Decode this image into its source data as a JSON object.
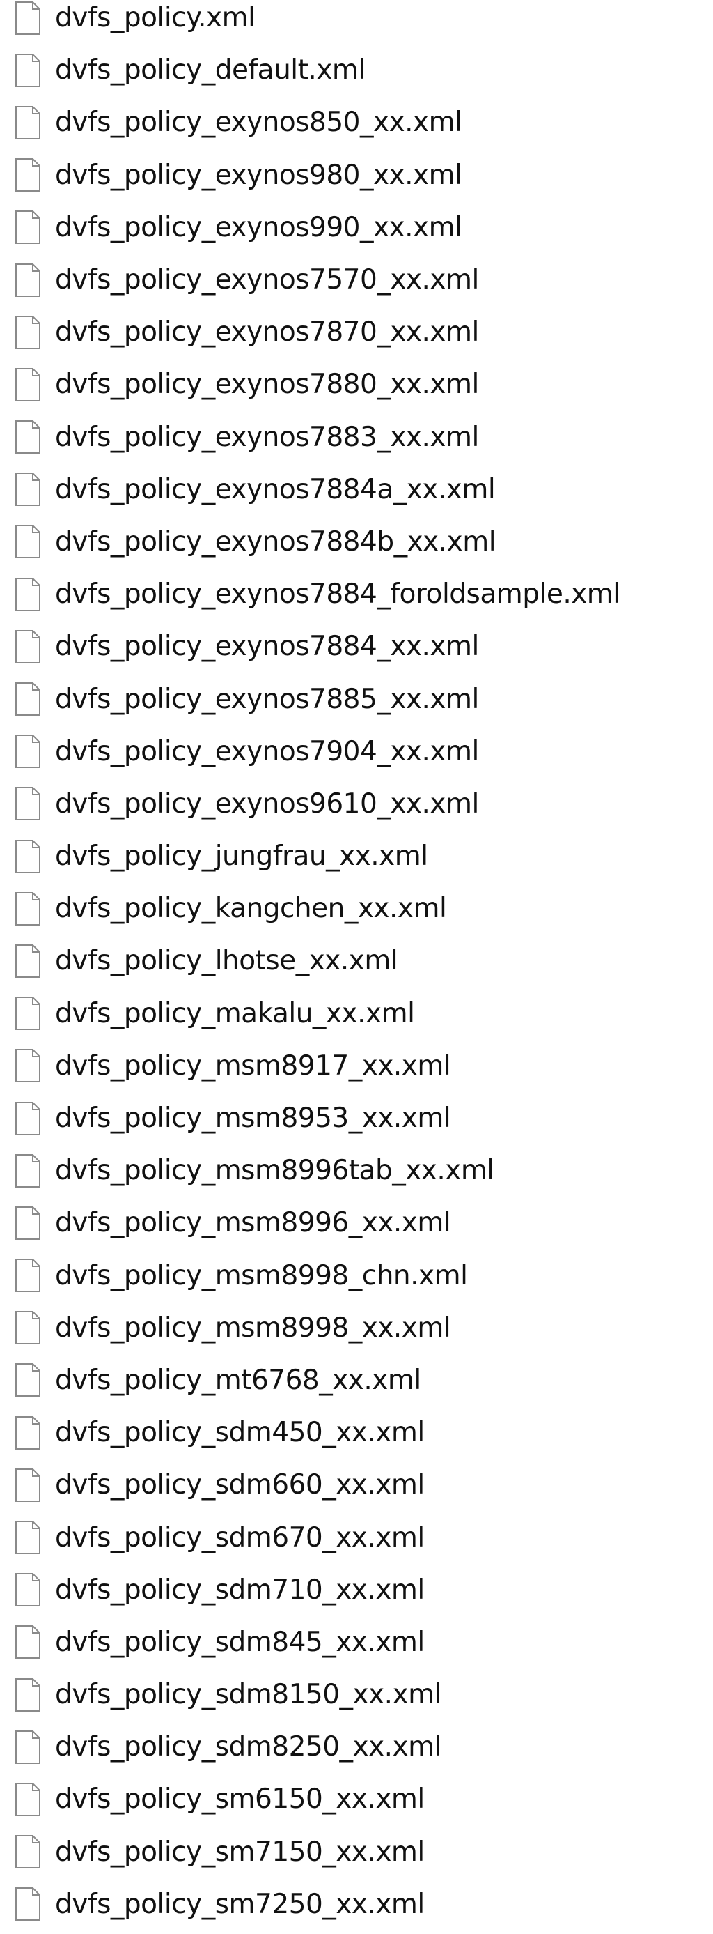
{
  "icons": {
    "file": "document-icon"
  },
  "colors": {
    "text": "#111111",
    "icon_stroke": "#8a8a8a",
    "icon_fill": "#ffffff"
  },
  "files": [
    "dvfs_policy.xml",
    "dvfs_policy_default.xml",
    "dvfs_policy_exynos850_xx.xml",
    "dvfs_policy_exynos980_xx.xml",
    "dvfs_policy_exynos990_xx.xml",
    "dvfs_policy_exynos7570_xx.xml",
    "dvfs_policy_exynos7870_xx.xml",
    "dvfs_policy_exynos7880_xx.xml",
    "dvfs_policy_exynos7883_xx.xml",
    "dvfs_policy_exynos7884a_xx.xml",
    "dvfs_policy_exynos7884b_xx.xml",
    "dvfs_policy_exynos7884_foroldsample.xml",
    "dvfs_policy_exynos7884_xx.xml",
    "dvfs_policy_exynos7885_xx.xml",
    "dvfs_policy_exynos7904_xx.xml",
    "dvfs_policy_exynos9610_xx.xml",
    "dvfs_policy_jungfrau_xx.xml",
    "dvfs_policy_kangchen_xx.xml",
    "dvfs_policy_lhotse_xx.xml",
    "dvfs_policy_makalu_xx.xml",
    "dvfs_policy_msm8917_xx.xml",
    "dvfs_policy_msm8953_xx.xml",
    "dvfs_policy_msm8996tab_xx.xml",
    "dvfs_policy_msm8996_xx.xml",
    "dvfs_policy_msm8998_chn.xml",
    "dvfs_policy_msm8998_xx.xml",
    "dvfs_policy_mt6768_xx.xml",
    "dvfs_policy_sdm450_xx.xml",
    "dvfs_policy_sdm660_xx.xml",
    "dvfs_policy_sdm670_xx.xml",
    "dvfs_policy_sdm710_xx.xml",
    "dvfs_policy_sdm845_xx.xml",
    "dvfs_policy_sdm8150_xx.xml",
    "dvfs_policy_sdm8250_xx.xml",
    "dvfs_policy_sm6150_xx.xml",
    "dvfs_policy_sm7150_xx.xml",
    "dvfs_policy_sm7250_xx.xml"
  ]
}
